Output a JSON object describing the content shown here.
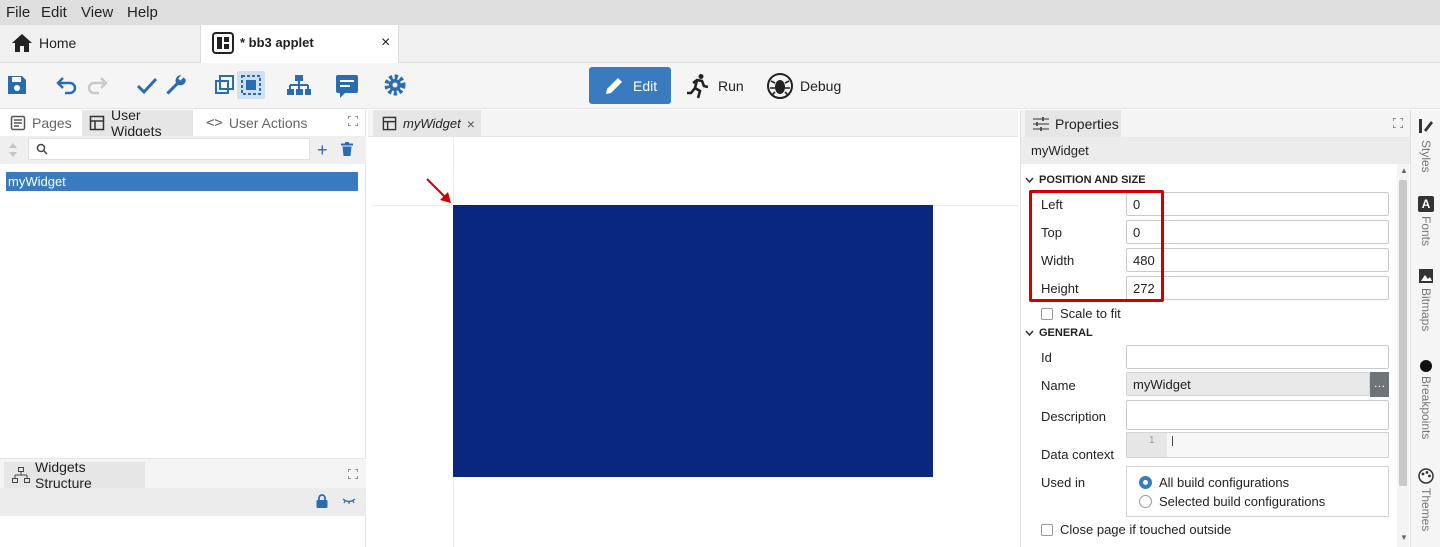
{
  "menubar": {
    "items": [
      "File",
      "Edit",
      "View",
      "Help"
    ]
  },
  "tabs": {
    "home": "Home",
    "applet": "* bb3 applet"
  },
  "modes": {
    "edit": "Edit",
    "run": "Run",
    "debug": "Debug"
  },
  "left_panel": {
    "tabs": [
      "Pages",
      "User Widgets",
      "User Actions"
    ],
    "active_tab": "User Widgets",
    "search_placeholder": "",
    "items": [
      "myWidget"
    ],
    "structure_title": "Widgets Structure"
  },
  "center": {
    "tab_label": "myWidget",
    "widget_color": "#0a2780"
  },
  "properties": {
    "title": "Properties",
    "object_name": "myWidget",
    "position_section": "POSITION AND SIZE",
    "fields": [
      {
        "label": "Left",
        "value": "0"
      },
      {
        "label": "Top",
        "value": "0"
      },
      {
        "label": "Width",
        "value": "480"
      },
      {
        "label": "Height",
        "value": "272"
      }
    ],
    "scale_to_fit": "Scale to fit",
    "general_section": "GENERAL",
    "id_label": "Id",
    "id_value": "",
    "name_label": "Name",
    "name_value": "myWidget",
    "description_label": "Description",
    "data_context_label": "Data context",
    "data_context_line": "1",
    "used_in_label": "Used in",
    "used_in_options": [
      "All build configurations",
      "Selected build configurations"
    ],
    "used_in_selected": "All build configurations",
    "close_page_label": "Close page if touched outside"
  },
  "side_tabs": [
    "Styles",
    "Fonts",
    "Bitmaps",
    "Breakpoints",
    "Themes"
  ],
  "colors": {
    "accent": "#3a7bbf",
    "highlight": "#d00000",
    "widget": "#0a2780"
  }
}
